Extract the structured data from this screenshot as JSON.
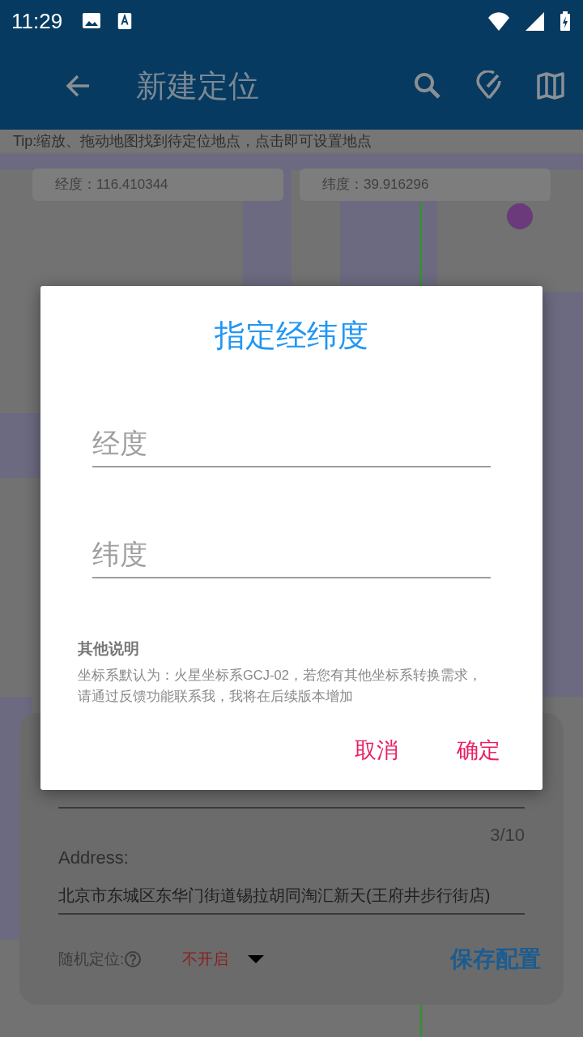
{
  "status_bar": {
    "time": "11:29"
  },
  "app_bar": {
    "title": "新建定位"
  },
  "map": {
    "tip": "Tip:缩放、拖动地图找到待定位地点，点击即可设置地点",
    "longitude": "经度：116.410344",
    "latitude": "纬度：39.916296"
  },
  "location_form": {
    "counter": "3/10",
    "address_label": "Address:",
    "address_value": "北京市东城区东华门街道锡拉胡同淘汇新天(王府井步行街店)",
    "random_label": "随机定位:",
    "random_value": "不开启",
    "save_button": "保存配置"
  },
  "dialog": {
    "title": "指定经纬度",
    "fields": [
      {
        "placeholder": "经度"
      },
      {
        "placeholder": "纬度"
      }
    ],
    "note_title": "其他说明",
    "note_text": "坐标系默认为：火星坐标系GCJ-02，若您有其他坐标系转换需求，请通过反馈功能联系我，我将在后续版本增加",
    "buttons": [
      "取消",
      "确定"
    ]
  }
}
